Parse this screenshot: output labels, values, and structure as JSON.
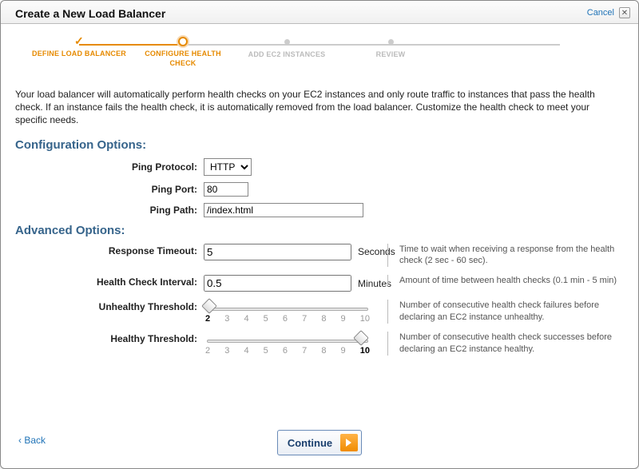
{
  "header": {
    "title": "Create a New Load Balancer",
    "cancel": "Cancel"
  },
  "stepper": {
    "steps": [
      {
        "label": "DEFINE LOAD BALANCER"
      },
      {
        "label": "CONFIGURE HEALTH CHECK"
      },
      {
        "label": "ADD EC2 INSTANCES"
      },
      {
        "label": "REVIEW"
      }
    ]
  },
  "intro": "Your load balancer will automatically perform health checks on your EC2 instances and only route traffic to instances that pass the health check. If an instance fails the health check, it is automatically removed from the load balancer. Customize the health check to meet your specific needs.",
  "config": {
    "heading": "Configuration Options:",
    "ping_protocol_label": "Ping Protocol:",
    "ping_protocol_value": "HTTP",
    "ping_port_label": "Ping Port:",
    "ping_port_value": "80",
    "ping_path_label": "Ping Path:",
    "ping_path_value": "/index.html"
  },
  "advanced": {
    "heading": "Advanced Options:",
    "response_timeout_label": "Response Timeout:",
    "response_timeout_value": "5",
    "response_timeout_unit": "Seconds",
    "response_timeout_help": "Time to wait when receiving a response from the health check (2 sec - 60 sec).",
    "interval_label": "Health Check Interval:",
    "interval_value": "0.5",
    "interval_unit": "Minutes",
    "interval_help": "Amount of time between health checks (0.1 min - 5 min)",
    "unhealthy_label": "Unhealthy Threshold:",
    "unhealthy_value": 2,
    "unhealthy_help": "Number of consecutive health check failures before declaring an EC2 instance unhealthy.",
    "healthy_label": "Healthy Threshold:",
    "healthy_value": 10,
    "healthy_help": "Number of consecutive health check successes before declaring an EC2 instance healthy.",
    "ticks": [
      "2",
      "3",
      "4",
      "5",
      "6",
      "7",
      "8",
      "9",
      "10"
    ]
  },
  "footer": {
    "back": "‹ Back",
    "continue": "Continue"
  }
}
